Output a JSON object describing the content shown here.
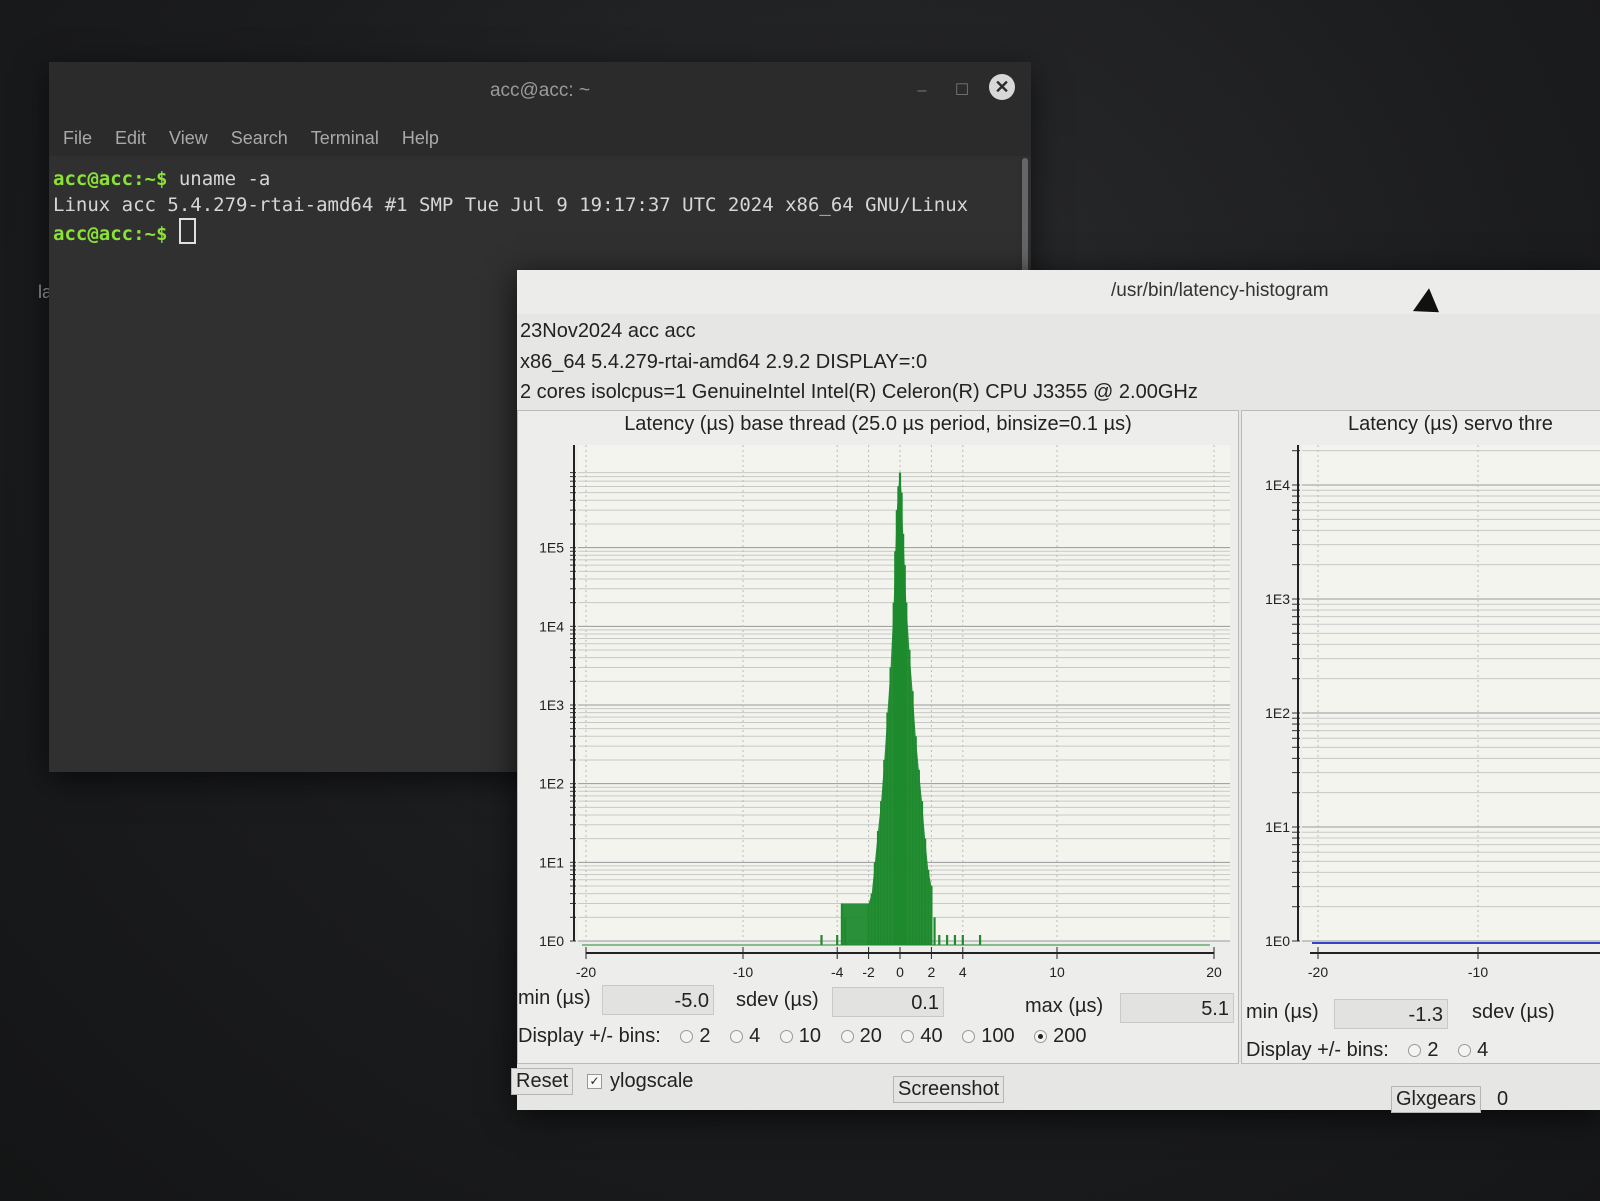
{
  "desktop": {
    "label": "la"
  },
  "terminal": {
    "title": "acc@acc: ~",
    "menu": [
      "File",
      "Edit",
      "View",
      "Search",
      "Terminal",
      "Help"
    ],
    "lines": [
      {
        "prompt": "acc@acc:~$",
        "command": " uname -a"
      },
      {
        "output": "Linux acc 5.4.279-rtai-amd64 #1 SMP Tue Jul 9 19:17:37 UTC 2024 x86_64 GNU/Linux"
      },
      {
        "prompt": "acc@acc:~$",
        "command": " "
      }
    ]
  },
  "latency_window": {
    "title": "/usr/bin/latency-histogram",
    "info_lines": [
      "23Nov2024 acc acc",
      " x86_64  5.4.279-rtai-amd64  2.9.2  DISPLAY=:0",
      " 2 cores  isolcpus=1   GenuineIntel  Intel(R) Celeron(R) CPU J3355 @ 2.00GHz"
    ],
    "base": {
      "title": "Latency (µs) base thread (25.0 µs period, binsize=0.1 µs)",
      "min_label": "min (µs)",
      "min_value": "-5.0",
      "sdev_label": "sdev (µs)",
      "sdev_value": "0.1",
      "max_label": "max (µs)",
      "max_value": "5.1",
      "bins_label": "Display +/- bins:",
      "bins": [
        "2",
        "4",
        "10",
        "20",
        "40",
        "100",
        "200"
      ],
      "bins_selected": "200"
    },
    "servo": {
      "title": "Latency (µs) servo thre",
      "min_label": "min (µs)",
      "min_value": "-1.3",
      "sdev_label": "sdev (µs)",
      "bins_label": "Display +/- bins:",
      "bins": [
        "2",
        "4"
      ]
    },
    "footer": {
      "reset": "Reset",
      "ylogscale": "ylogscale",
      "ylogscale_checked": true,
      "screenshot": "Screenshot",
      "glxgears": "Glxgears",
      "glxgears_value": "0"
    },
    "colors": {
      "histogram": "#1f8a2e",
      "servo_line": "#3344cc",
      "plot_bg": "#f3f4ee"
    }
  },
  "chart_data": [
    {
      "type": "bar",
      "title": "Latency (µs) base thread (25.0 µs period, binsize=0.1 µs)",
      "xlabel": "",
      "ylabel": "",
      "x_ticks": [
        "-20",
        "-10",
        "-4",
        "-2",
        "0",
        "2",
        "4",
        "10",
        "20"
      ],
      "y_ticks": [
        "1E0",
        "1E1",
        "1E2",
        "1E3",
        "1E4",
        "1E5"
      ],
      "xlim": [
        -20,
        20
      ],
      "ylim": [
        1,
        1000000
      ],
      "yscale": "log",
      "grid": true,
      "x": [
        -5.0,
        -4.0,
        -3.7,
        -3.5,
        -2.0,
        -1.8,
        -1.6,
        -1.4,
        -1.2,
        -1.0,
        -0.8,
        -0.6,
        -0.4,
        -0.3,
        -0.2,
        -0.1,
        0.0,
        0.1,
        0.2,
        0.3,
        0.4,
        0.6,
        0.8,
        1.0,
        1.2,
        1.4,
        1.6,
        1.8,
        2.0,
        2.2,
        2.5,
        3.0,
        3.5,
        4.0,
        5.1
      ],
      "values": [
        1,
        1,
        3,
        2,
        3,
        4,
        10,
        25,
        60,
        200,
        800,
        3000,
        20000,
        90000,
        300000,
        600000,
        900000,
        500000,
        150000,
        60000,
        20000,
        5000,
        1500,
        400,
        150,
        60,
        20,
        8,
        5,
        2,
        1,
        1,
        1,
        1,
        1
      ]
    },
    {
      "type": "line",
      "title": "Latency (µs) servo thre",
      "x_ticks": [
        "-20",
        "-10"
      ],
      "y_ticks": [
        "1E0",
        "1E1",
        "1E2",
        "1E3",
        "1E4"
      ],
      "yscale": "log",
      "grid": true,
      "series": [
        {
          "values": [
            1,
            1
          ]
        }
      ]
    }
  ]
}
